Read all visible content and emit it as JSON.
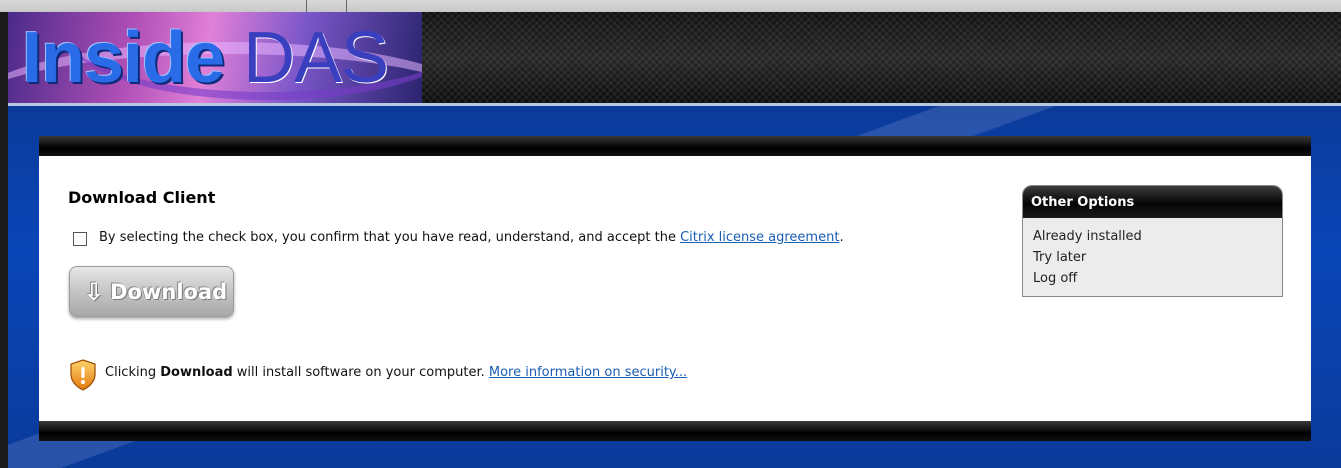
{
  "header": {
    "logo_inside": "Inside",
    "logo_das": "DAS"
  },
  "main": {
    "title": "Download Client",
    "license": {
      "prefix": "By selecting the check box, you confirm that you have read, understand, and accept the ",
      "link": "Citrix license agreement",
      "suffix": "."
    },
    "download_button": "Download",
    "security": {
      "prefix": "Clicking ",
      "bold": "Download",
      "middle": " will install software on your computer. ",
      "link": "More information on security..."
    }
  },
  "other_options": {
    "title": "Other Options",
    "items": [
      "Already installed",
      "Try later",
      "Log off"
    ]
  },
  "icons": {
    "download_arrow": "arrow-down-icon",
    "security_shield": "shield-warning-icon"
  }
}
